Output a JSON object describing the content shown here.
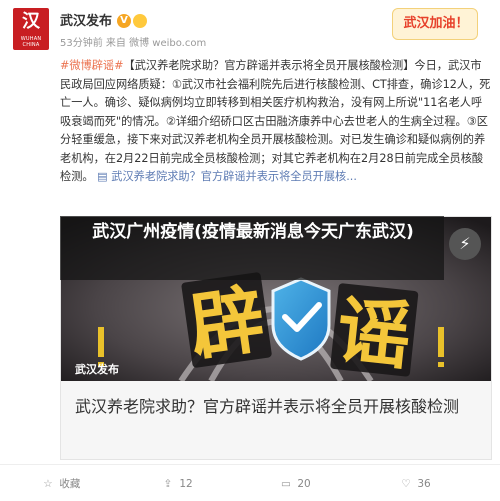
{
  "account": {
    "avatar_text": "汉",
    "avatar_sub": "WUHAN CHINA",
    "name": "武汉发布",
    "meta": "53分钟前 来自 微博 weibo.com",
    "badge": "武汉加油！"
  },
  "post": {
    "hashtag": "#微博辟谣#",
    "text": "【武汉养老院求助？官方辟谣并表示将全员开展核酸检测】今日，武汉市民政局回应网络质疑：①武汉市社会福利院先后进行核酸检测、CT排查，确诊12人，死亡一人。确诊、疑似病例均立即转移到相关医疗机构救治，没有网上所说\"11名老人呼吸衰竭而死\"的情况。②详细介绍硚口区古田融济康养中心去世老人的生病全过程。③区分轻重缓急，接下来对武汉养老机构全员开展核酸检测。对已发生确诊和疑似病例的养老机构，在2月22日前完成全员核酸检测；对其它养老机构在2月28日前完成全员核酸检测。 ",
    "link_icon": "link-icon",
    "link_text": "武汉养老院求助？官方辟谣并表示将全员开展核..."
  },
  "overlay": {
    "title": "武汉广州疫情(疫情最新消息今天广东武汉)",
    "flash_icon": "lightning-icon"
  },
  "card": {
    "image_text_1": "辟",
    "image_text_2": "谣",
    "watermark": "武汉发布",
    "caption": "武汉养老院求助？官方辟谣并表示将全员开展核酸检测"
  },
  "actions": {
    "favorite": "收藏",
    "repost": "12",
    "comment": "20",
    "like": "36"
  },
  "colors": {
    "brand_red": "#c81e22",
    "hashtag": "#eb7350",
    "link": "#5d7bb3"
  }
}
